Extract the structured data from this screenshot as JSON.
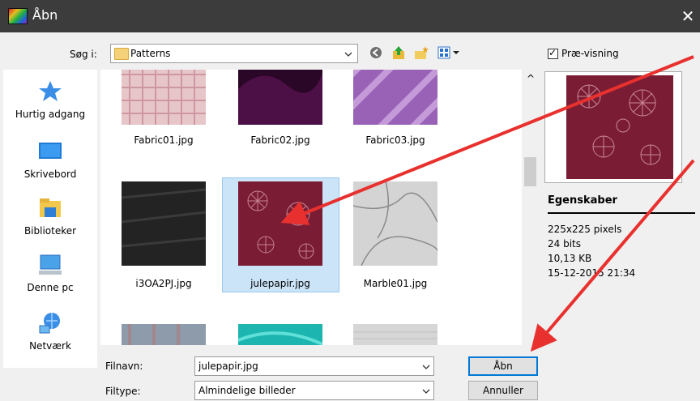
{
  "window": {
    "title": "Åbn",
    "close_glyph": "✕"
  },
  "lookin": {
    "label": "Søg i:",
    "value": "Patterns"
  },
  "toolbar": {
    "back_glyph": "◀",
    "up_glyph": "⬆",
    "newfolder_glyph": "✦",
    "views_glyph": "☷"
  },
  "sidebar": {
    "items": [
      {
        "label": "Hurtig adgang",
        "icon": "star-icon"
      },
      {
        "label": "Skrivebord",
        "icon": "desktop-icon"
      },
      {
        "label": "Biblioteker",
        "icon": "library-icon"
      },
      {
        "label": "Denne pc",
        "icon": "computer-icon"
      },
      {
        "label": "Netværk",
        "icon": "network-icon"
      }
    ]
  },
  "files": [
    {
      "name": "Fabric01.jpg",
      "color": "#e6c6c9"
    },
    {
      "name": "Fabric02.jpg",
      "color": "#3a0b35"
    },
    {
      "name": "Fabric03.jpg",
      "color": "#9d5fb8"
    },
    {
      "name": "i3OA2PJ.jpg",
      "color": "#232323"
    },
    {
      "name": "julepapir.jpg",
      "color": "#7d1d34",
      "selected": true
    },
    {
      "name": "Marble01.jpg",
      "color": "#d2d2d2"
    },
    {
      "name": "",
      "color": "#8a98a8"
    },
    {
      "name": "",
      "color": "#1eb7b1"
    },
    {
      "name": "",
      "color": "#d6d6d6"
    }
  ],
  "preview": {
    "checkbox_label": "Præ-visning",
    "checked": true
  },
  "properties": {
    "title": "Egenskaber",
    "lines": [
      "225x225 pixels",
      "24 bits",
      "10,13 KB",
      "15-12-2015 21:34"
    ]
  },
  "filename": {
    "label": "Filnavn:",
    "value": "julepapir.jpg"
  },
  "filetype": {
    "label": "Filtype:",
    "value": "Almindelige billeder"
  },
  "buttons": {
    "open": "Åbn",
    "cancel": "Annuller"
  },
  "scroll": {
    "up_glyph": "^",
    "down_glyph": "v"
  },
  "colors": {
    "selection": "#cce4f7",
    "arrow": "#e8312e",
    "titlebar": "#3c3c3c"
  }
}
